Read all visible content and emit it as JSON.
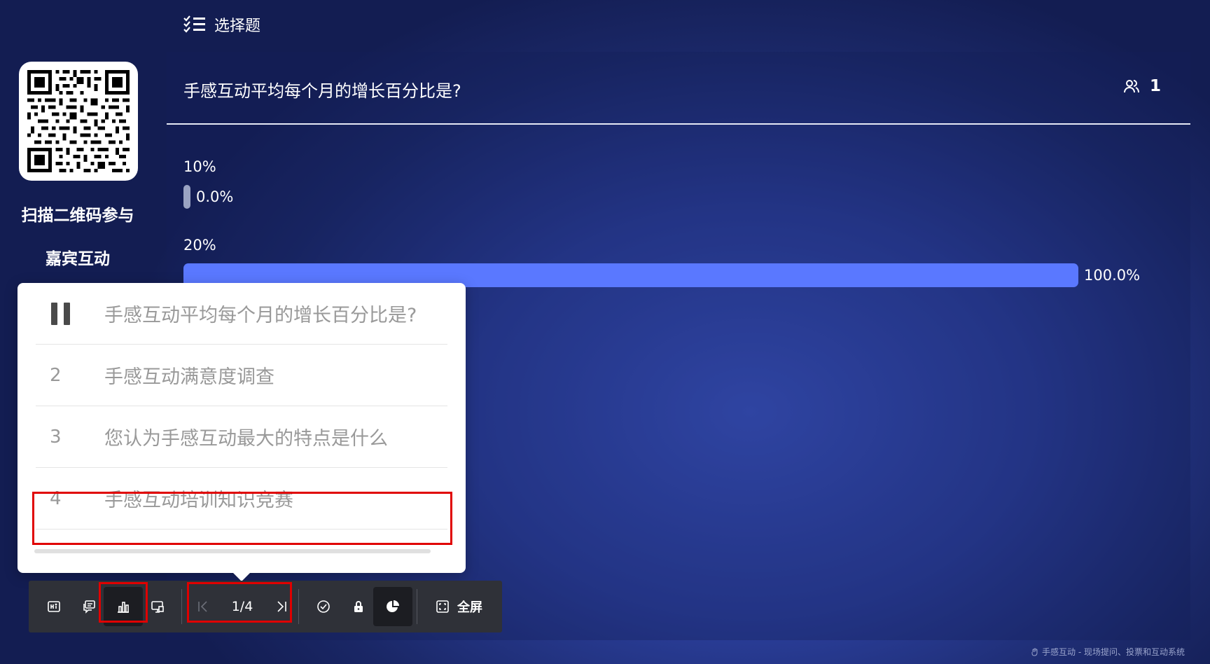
{
  "header": {
    "title": "选择题",
    "icon": "checklist-icon"
  },
  "sidebar": {
    "scan_text": "扫描二维码参与",
    "guest_text": "嘉宾互动"
  },
  "question": {
    "title": "手感互动平均每个月的增长百分比是?",
    "participant_count": "1",
    "options": [
      {
        "label": "10%",
        "percent_text": "0.0%",
        "value": 0.0
      },
      {
        "label": "20%",
        "percent_text": "100.0%",
        "value": 100.0
      }
    ]
  },
  "popup": {
    "items": [
      {
        "number": "",
        "text": "手感互动平均每个月的增长百分比是?",
        "state": "playing"
      },
      {
        "number": "2",
        "text": "手感互动满意度调查"
      },
      {
        "number": "3",
        "text": "您认为手感互动最大的特点是什么"
      },
      {
        "number": "4",
        "text": "手感互动培训知识竞赛"
      }
    ]
  },
  "toolbar": {
    "page_indicator": "1/4",
    "fullscreen_label": "全屏",
    "icons": [
      "hi-icon",
      "comment-icon",
      "bar-chart-icon",
      "screen-icon",
      "prev-icon",
      "next-icon",
      "check-circle-icon",
      "lock-icon",
      "pie-chart-icon",
      "fullscreen-icon"
    ]
  },
  "footer": {
    "text": "手感互动 - 现场提问、投票和互动系统"
  },
  "colors": {
    "bar": "#5a78ff",
    "highlight": "#e00000",
    "toolbar": "#2f3138"
  }
}
